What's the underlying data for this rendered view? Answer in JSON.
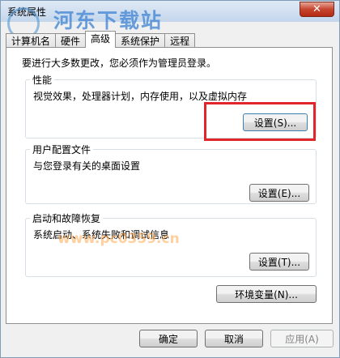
{
  "window": {
    "title": "系统属性",
    "close_label": "✕"
  },
  "watermark": {
    "site": "河东下载站",
    "url": "www.pc0359.cn"
  },
  "tabs": [
    {
      "label": "计算机名",
      "active": false
    },
    {
      "label": "硬件",
      "active": false
    },
    {
      "label": "高级",
      "active": true
    },
    {
      "label": "系统保护",
      "active": false
    },
    {
      "label": "远程",
      "active": false
    }
  ],
  "note": "要进行大多数更改，您必须作为管理员登录。",
  "performance": {
    "title": "性能",
    "description": "视觉效果，处理器计划，内存使用，以及虚拟内存",
    "button": "设置(S)..."
  },
  "profiles": {
    "title": "用户配置文件",
    "description": "与您登录有关的桌面设置",
    "button": "设置(E)..."
  },
  "startup": {
    "title": "启动和故障恢复",
    "description": "系统启动、系统失败和调试信息",
    "button": "设置(T)..."
  },
  "env_button": "环境变量(N)...",
  "footer": {
    "ok": "确定",
    "cancel": "取消",
    "apply": "应用(A)"
  }
}
